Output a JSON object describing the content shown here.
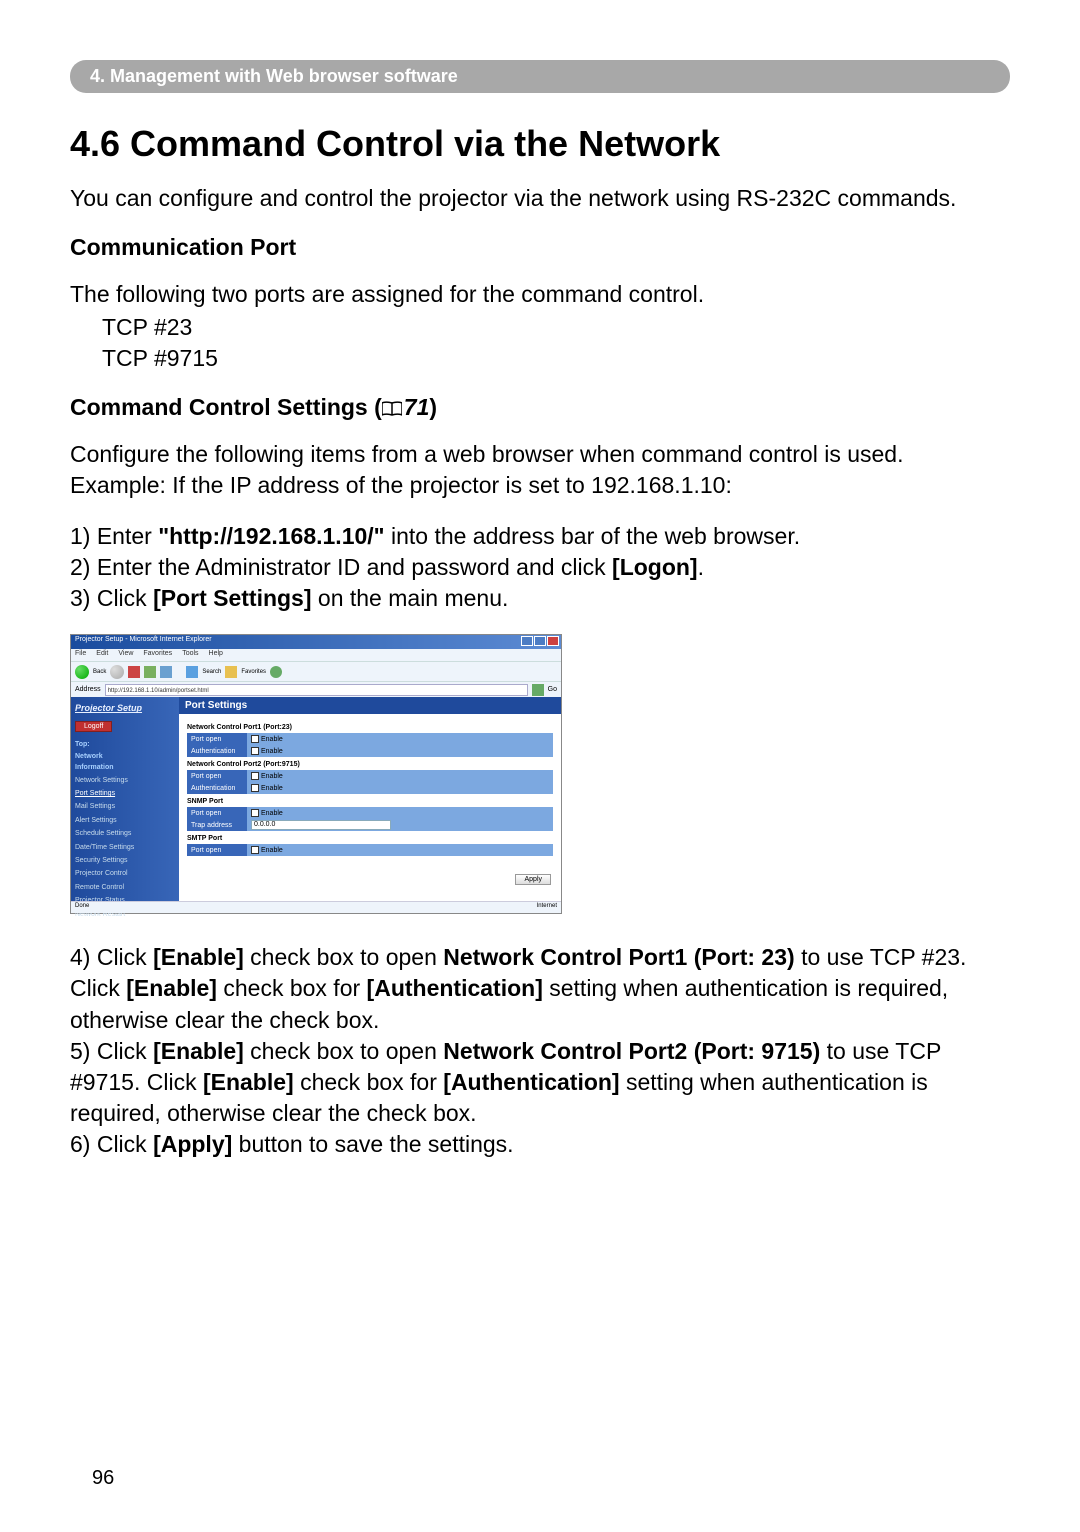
{
  "header": "4. Management with Web browser software",
  "section_title": "4.6 Command Control via the Network",
  "intro": "You can configure and control the projector via the network using RS-232C commands.",
  "comm_port": {
    "title": "Communication Port",
    "lead": "The following two ports are assigned for the command control.",
    "port1": "TCP #23",
    "port2": "TCP #9715"
  },
  "cc_settings": {
    "title_prefix": "Command Control Settings (",
    "ref": "71",
    "title_suffix": ")"
  },
  "config_intro1": "Configure the following items from a web browser when command control is used.",
  "config_intro2": "Example: If the IP address of the projector is set to 192.168.1.10:",
  "steps_a": {
    "s1_pre": "1) Enter ",
    "s1_bold": "\"http://192.168.1.10/\"",
    "s1_post": " into the address bar of the web browser.",
    "s2_pre": "2) Enter the Administrator ID and password and click ",
    "s2_bold": "[Logon]",
    "s2_post": ".",
    "s3_pre": "3) Click ",
    "s3_bold": "[Port Settings]",
    "s3_post": " on the main menu."
  },
  "steps_b": {
    "s4_pre": "4) Click ",
    "s4_b1": "[Enable]",
    "s4_mid1": " check box to open ",
    "s4_b2": "Network Control Port1 (Port: 23)",
    "s4_mid2": " to use TCP #23. Click ",
    "s4_b3": "[Enable]",
    "s4_mid3": " check box for ",
    "s4_b4": "[Authentication]",
    "s4_post": " setting when authentication is required, otherwise clear the check box.",
    "s5_pre": "5) Click ",
    "s5_b1": "[Enable]",
    "s5_mid1": " check box to open ",
    "s5_b2": "Network Control Port2 (Port: 9715)",
    "s5_mid2": " to use TCP #9715. Click ",
    "s5_b3": "[Enable]",
    "s5_mid3": " check box for ",
    "s5_b4": "[Authentication]",
    "s5_post": " setting when authentication is required, otherwise clear the check box.",
    "s6_pre": "6) Click ",
    "s6_b1": "[Apply]",
    "s6_post": " button to save the settings."
  },
  "screenshot": {
    "window_title": "Projector Setup - Microsoft Internet Explorer",
    "menu": [
      "File",
      "Edit",
      "View",
      "Favorites",
      "Tools",
      "Help"
    ],
    "address_label": "Address",
    "address_value": "http://192.168.1.10/admin/portset.html",
    "go": "Go",
    "side_title": "Projector Setup",
    "logoff": "Logoff",
    "side_header1": "Top:",
    "side_header2": "Network",
    "side_header3": "Information",
    "side_items": [
      "Network Settings",
      "Port Settings",
      "Mail Settings",
      "Alert Settings",
      "Schedule Settings",
      "Date/Time Settings",
      "Security Settings",
      "Projector Control",
      "Remote Control",
      "Projector Status",
      "Network Restart"
    ],
    "main_title": "Port Settings",
    "groups": {
      "g1": "Network Control Port1 (Port:23)",
      "g2": "Network Control Port2 (Port:9715)",
      "g3": "SNMP Port",
      "g4": "SMTP Port"
    },
    "labels": {
      "port_open": "Port open",
      "auth": "Authentication",
      "trap": "Trap address",
      "enable": "Enable"
    },
    "trap_value": "0.0.0.0",
    "apply": "Apply",
    "status_left": "Done",
    "status_right": "Internet"
  },
  "page_number": "96"
}
